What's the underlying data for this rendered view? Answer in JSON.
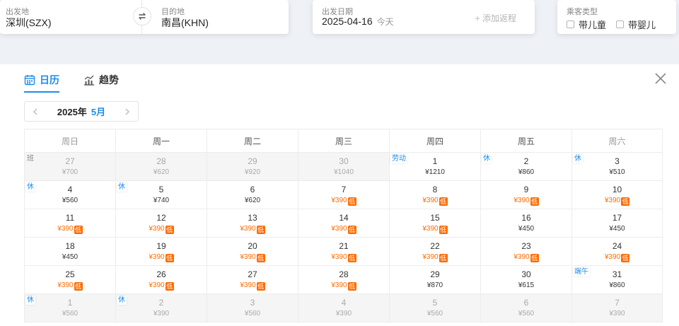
{
  "search": {
    "from_label": "出发地",
    "from_value": "深圳(SZX)",
    "to_label": "目的地",
    "to_value": "南昌(KHN)",
    "date_label": "出发日期",
    "date_value": "2025-04-16",
    "date_today": "今天",
    "add_return": "+ 添加返程",
    "pax_label": "乘客类型",
    "pax_child": "带儿童",
    "pax_infant": "带婴儿"
  },
  "tabs": {
    "calendar": "日历",
    "trend": "趋势"
  },
  "month_nav": {
    "year": "2025年",
    "month": "5月"
  },
  "weekdays": [
    "周日",
    "周一",
    "周二",
    "周三",
    "周四",
    "周五",
    "周六"
  ],
  "colors": {
    "accent": "#1c8cec",
    "low_price": "#ff6a00"
  },
  "icons": {
    "calendar": "calendar-icon",
    "trend": "trend-chart-icon",
    "close": "close-icon",
    "swap": "swap-icon",
    "prev": "chevron-left-icon",
    "next": "chevron-right-icon"
  },
  "weeks": [
    [
      {
        "day": "27",
        "price": "¥700",
        "other": true,
        "tag": "班",
        "tag_type": "work"
      },
      {
        "day": "28",
        "price": "¥620",
        "other": true
      },
      {
        "day": "29",
        "price": "¥920",
        "other": true
      },
      {
        "day": "30",
        "price": "¥1040",
        "other": true
      },
      {
        "day": "1",
        "price": "¥1210",
        "tag": "劳动"
      },
      {
        "day": "2",
        "price": "¥860",
        "tag": "休"
      },
      {
        "day": "3",
        "price": "¥510",
        "tag": "休"
      }
    ],
    [
      {
        "day": "4",
        "price": "¥560",
        "tag": "休"
      },
      {
        "day": "5",
        "price": "¥740",
        "tag": "休"
      },
      {
        "day": "6",
        "price": "¥620"
      },
      {
        "day": "7",
        "price": "¥390",
        "low": true
      },
      {
        "day": "8",
        "price": "¥390",
        "low": true
      },
      {
        "day": "9",
        "price": "¥390",
        "low": true
      },
      {
        "day": "10",
        "price": "¥390",
        "low": true
      }
    ],
    [
      {
        "day": "11",
        "price": "¥390",
        "low": true
      },
      {
        "day": "12",
        "price": "¥390",
        "low": true
      },
      {
        "day": "13",
        "price": "¥390",
        "low": true
      },
      {
        "day": "14",
        "price": "¥390",
        "low": true
      },
      {
        "day": "15",
        "price": "¥390",
        "low": true
      },
      {
        "day": "16",
        "price": "¥450"
      },
      {
        "day": "17",
        "price": "¥450"
      }
    ],
    [
      {
        "day": "18",
        "price": "¥450"
      },
      {
        "day": "19",
        "price": "¥390",
        "low": true
      },
      {
        "day": "20",
        "price": "¥390",
        "low": true
      },
      {
        "day": "21",
        "price": "¥390",
        "low": true
      },
      {
        "day": "22",
        "price": "¥390",
        "low": true
      },
      {
        "day": "23",
        "price": "¥390",
        "low": true
      },
      {
        "day": "24",
        "price": "¥390",
        "low": true
      }
    ],
    [
      {
        "day": "25",
        "price": "¥390",
        "low": true
      },
      {
        "day": "26",
        "price": "¥390",
        "low": true
      },
      {
        "day": "27",
        "price": "¥390",
        "low": true
      },
      {
        "day": "28",
        "price": "¥390",
        "low": true
      },
      {
        "day": "29",
        "price": "¥870"
      },
      {
        "day": "30",
        "price": "¥615"
      },
      {
        "day": "31",
        "price": "¥860",
        "tag": "端午"
      }
    ],
    [
      {
        "day": "1",
        "price": "¥560",
        "other": true,
        "tag": "休"
      },
      {
        "day": "2",
        "price": "¥390",
        "other": true,
        "tag": "休"
      },
      {
        "day": "3",
        "price": "¥560",
        "other": true
      },
      {
        "day": "4",
        "price": "¥390",
        "other": true
      },
      {
        "day": "5",
        "price": "¥560",
        "other": true
      },
      {
        "day": "6",
        "price": "¥560",
        "other": true
      },
      {
        "day": "7",
        "price": "¥390",
        "other": true
      }
    ]
  ],
  "low_badge": "低"
}
